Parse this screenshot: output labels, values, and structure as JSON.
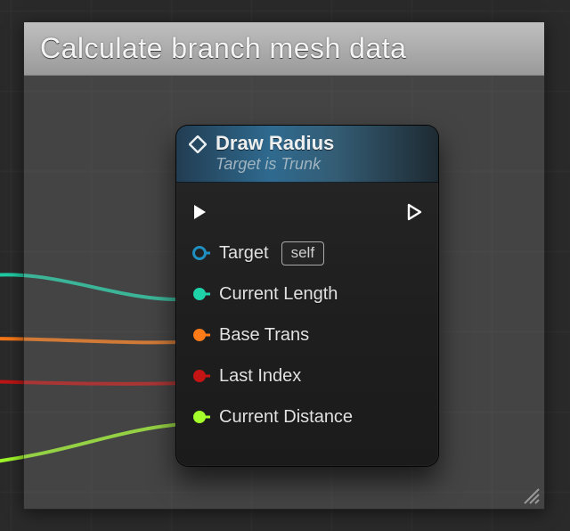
{
  "comment": {
    "title": "Calculate branch mesh data"
  },
  "node": {
    "title": "Draw Radius",
    "subtitle": "Target is Trunk",
    "target_label": "Target",
    "target_chip": "self",
    "pins": [
      {
        "label": "Current Length",
        "color": "#1fd3a9"
      },
      {
        "label": "Base Trans",
        "color": "#ff7b18"
      },
      {
        "label": "Last Index",
        "color": "#c41414"
      },
      {
        "label": "Current Distance",
        "color": "#a4ff2a"
      }
    ],
    "wire_colors": {
      "current_length": "#1fd3a9",
      "base_trans": "#ff7b18",
      "last_index": "#c41414",
      "current_distance": "#a4ff2a"
    }
  }
}
